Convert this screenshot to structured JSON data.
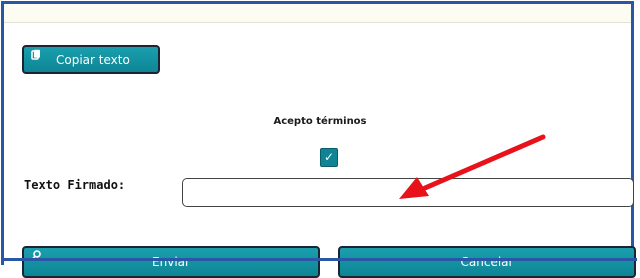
{
  "toolbar": {
    "copy_label": "Copiar texto"
  },
  "terms": {
    "label": "Acepto términos",
    "checked": true,
    "check_glyph": "✓"
  },
  "signed_text": {
    "label": "Texto Firmado:",
    "value": "",
    "placeholder": ""
  },
  "actions": {
    "send_label": "Enviar",
    "cancel_label": "Cancelar"
  },
  "icons": {
    "copy": "copy-icon",
    "send": "search-icon"
  },
  "colors": {
    "button": "#1196a5",
    "frame": "#2a56a6",
    "arrow": "#e8121b"
  }
}
